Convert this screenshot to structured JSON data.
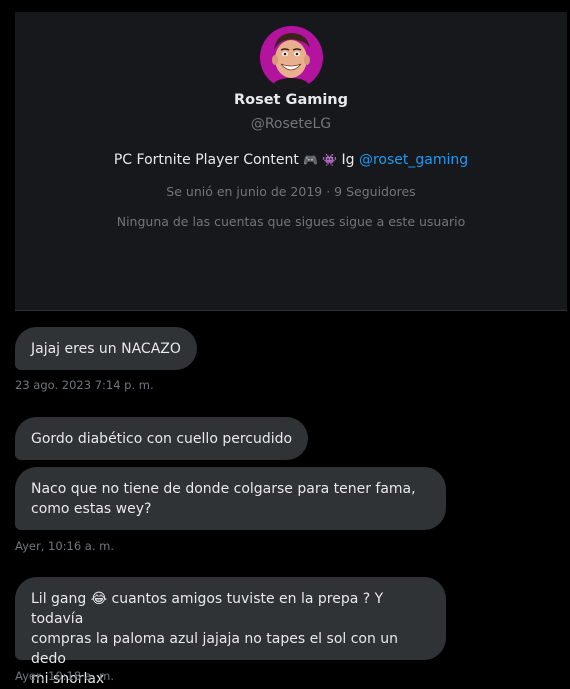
{
  "profile": {
    "display_name": "Roset Gaming",
    "handle": "@RoseteLG",
    "bio_prefix": "PC Fortnite Player Content",
    "bio_emojis": "🎮 👾",
    "bio_ig_text": "Ig",
    "bio_ig_link": "@roset_gaming",
    "joined_text": "Se unió en junio de 2019 · 9 Seguidores",
    "not_followed_text": "Ninguna de las cuentas que sigues sigue a este usuario",
    "avatar_color": "#c21bb0"
  },
  "messages": [
    {
      "text": "Jajaj eres un NACAZO"
    },
    {
      "text": "Gordo diabético con cuello percudido"
    },
    {
      "line1": "Naco que no tiene de donde colgarse para tener fama,",
      "line2": "como estas wey?"
    },
    {
      "emoji": "😂",
      "line1_rest": "cuantos amigos tuviste en la prepa ? Y todavía",
      "line1_start": "Lil gang",
      "line2": "compras la paloma azul jajaja no tapes el sol con un dedo",
      "line3": "mi snorlax"
    }
  ],
  "timestamps": [
    "23 ago. 2023 7:14 p. m.",
    "Ayer, 10:16 a. m.",
    "Ayer, 10:18 a. m."
  ],
  "colors": {
    "background": "#000000",
    "card": "#16181c",
    "bubble": "#2f3336",
    "muted": "#71767b",
    "link": "#1d9bf0"
  }
}
